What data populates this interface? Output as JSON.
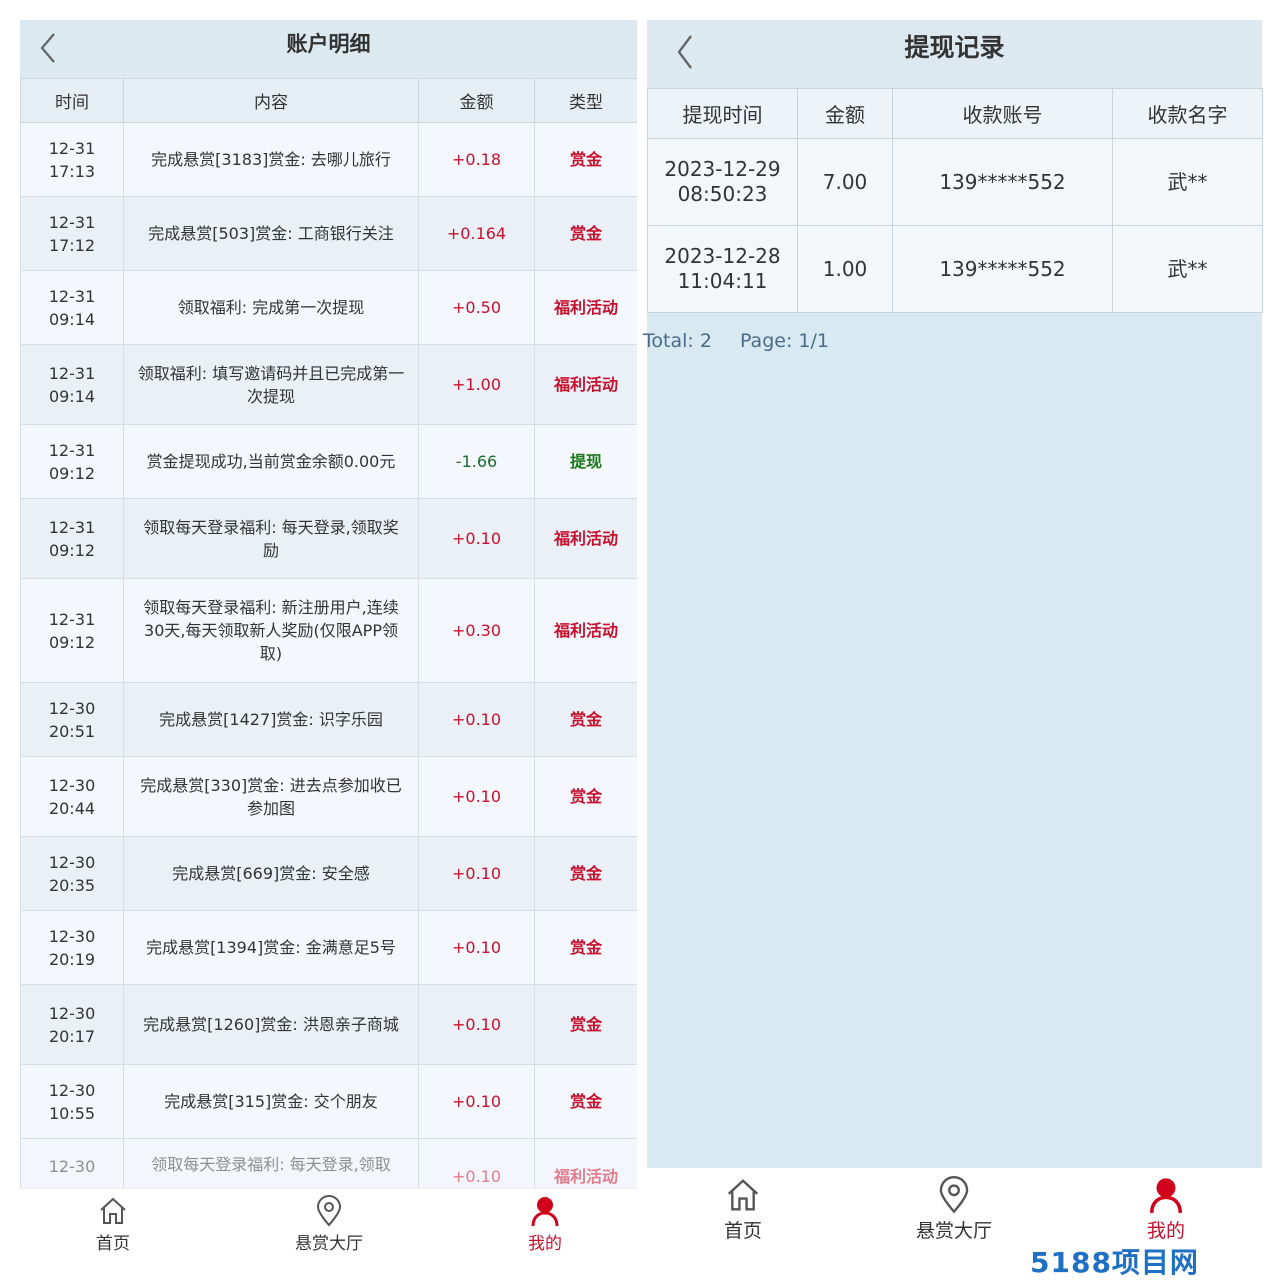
{
  "left": {
    "title": "账户明细",
    "columns": [
      "时间",
      "内容",
      "金额",
      "类型"
    ],
    "rows": [
      {
        "date": "12-31",
        "time": "17:13",
        "content": "完成悬赏[3183]赏金: 去哪儿旅行",
        "amount": "+0.18",
        "type": "赏金"
      },
      {
        "date": "12-31",
        "time": "17:12",
        "content": "完成悬赏[503]赏金: 工商银行关注",
        "amount": "+0.164",
        "type": "赏金"
      },
      {
        "date": "12-31",
        "time": "09:14",
        "content": "领取福利: 完成第一次提现",
        "amount": "+0.50",
        "type": "福利活动"
      },
      {
        "date": "12-31",
        "time": "09:14",
        "content": "领取福利: 填写邀请码并且已完成第一次提现",
        "amount": "+1.00",
        "type": "福利活动"
      },
      {
        "date": "12-31",
        "time": "09:12",
        "content": "赏金提现成功,当前赏金余额0.00元",
        "amount": "-1.66",
        "type": "提现"
      },
      {
        "date": "12-31",
        "time": "09:12",
        "content": "领取每天登录福利: 每天登录,领取奖励",
        "amount": "+0.10",
        "type": "福利活动"
      },
      {
        "date": "12-31",
        "time": "09:12",
        "content": "领取每天登录福利: 新注册用户,连续30天,每天领取新人奖励(仅限APP领取)",
        "amount": "+0.30",
        "type": "福利活动"
      },
      {
        "date": "12-30",
        "time": "20:51",
        "content": "完成悬赏[1427]赏金: 识字乐园",
        "amount": "+0.10",
        "type": "赏金"
      },
      {
        "date": "12-30",
        "time": "20:44",
        "content": "完成悬赏[330]赏金: 进去点参加收已参加图",
        "amount": "+0.10",
        "type": "赏金"
      },
      {
        "date": "12-30",
        "time": "20:35",
        "content": "完成悬赏[669]赏金: 安全感",
        "amount": "+0.10",
        "type": "赏金"
      },
      {
        "date": "12-30",
        "time": "20:19",
        "content": "完成悬赏[1394]赏金: 金满意足5号",
        "amount": "+0.10",
        "type": "赏金"
      },
      {
        "date": "12-30",
        "time": "20:17",
        "content": "完成悬赏[1260]赏金: 洪恩亲子商城",
        "amount": "+0.10",
        "type": "赏金"
      },
      {
        "date": "12-30",
        "time": "10:55",
        "content": "完成悬赏[315]赏金: 交个朋友",
        "amount": "+0.10",
        "type": "赏金"
      },
      {
        "date": "12-30",
        "time": "",
        "content": "领取每天登录福利: 每天登录,领取",
        "amount": "+0.10",
        "type": "福利活动"
      }
    ],
    "nav": {
      "home": "首页",
      "hall": "悬赏大厅",
      "mine": "我的"
    }
  },
  "right": {
    "title": "提现记录",
    "columns": [
      "提现时间",
      "金额",
      "收款账号",
      "收款名字"
    ],
    "rows": [
      {
        "date": "2023-12-29",
        "time": "08:50:23",
        "amount": "7.00",
        "account": "139*****552",
        "name": "武**"
      },
      {
        "date": "2023-12-28",
        "time": "11:04:11",
        "amount": "1.00",
        "account": "139*****552",
        "name": "武**"
      }
    ],
    "total": "Total: 2",
    "page": "Page: 1/1",
    "nav": {
      "home": "首页",
      "hall": "悬赏大厅",
      "mine": "我的"
    }
  },
  "watermark": "5188项目网",
  "colors": {
    "red": "#c8102e",
    "green": "#1a7a1a",
    "header": "#dde9f1",
    "page_bg": "#d8e9f1"
  },
  "icons": {
    "back": "chevron-left-icon",
    "home": "home-icon",
    "hall": "location-pin-icon",
    "mine": "user-icon"
  }
}
